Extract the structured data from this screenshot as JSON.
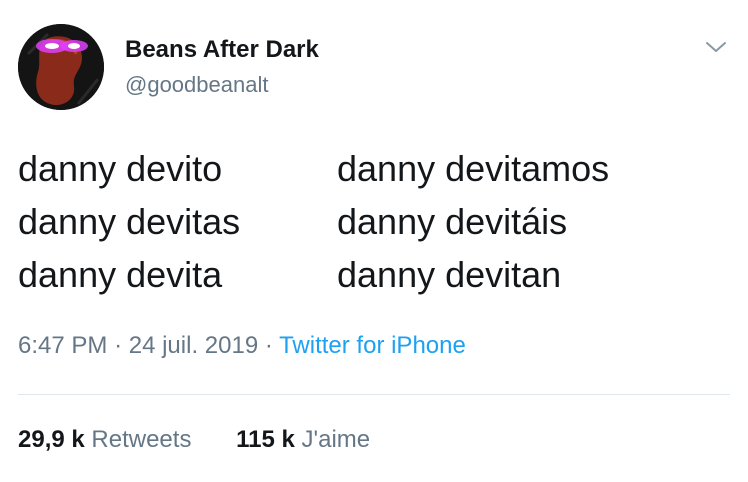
{
  "author": {
    "display_name": "Beans After Dark",
    "handle": "@goodbeanalt",
    "avatar_icon": "bean-with-glowing-eyes-avatar"
  },
  "tweet": {
    "lines": [
      {
        "left": "danny devito",
        "right": "danny devitamos"
      },
      {
        "left": "danny devitas",
        "right": "danny devitáis"
      },
      {
        "left": "danny devita",
        "right": "danny devitan"
      }
    ],
    "time": "6:47 PM",
    "separator": "·",
    "date": "24 juil. 2019",
    "source": "Twitter for iPhone"
  },
  "stats": {
    "retweets_count": "29,9 k",
    "retweets_label": "Retweets",
    "likes_count": "115 k",
    "likes_label": "J'aime"
  },
  "colors": {
    "link": "#1da1f2",
    "secondary": "#657786",
    "primary": "#14171a",
    "divider": "#e1e8ed"
  },
  "icons": {
    "menu": "chevron-down-icon"
  }
}
